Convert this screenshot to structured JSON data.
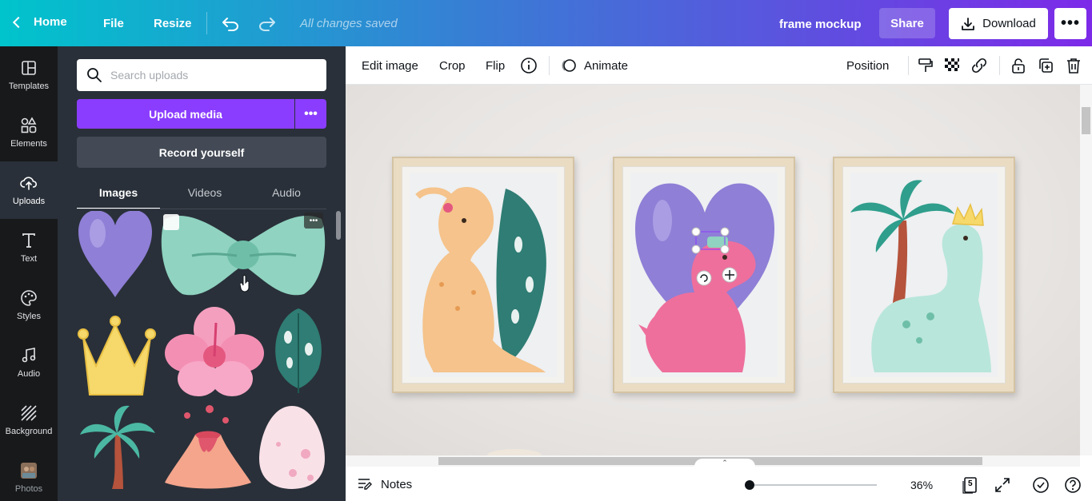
{
  "topbar": {
    "home_label": "Home",
    "file_label": "File",
    "resize_label": "Resize",
    "status": "All changes saved",
    "doc_title": "frame mockup",
    "share_label": "Share",
    "download_label": "Download",
    "gradient_colors": [
      "#00c4cc",
      "#3a7bd5",
      "#7d2ae8"
    ]
  },
  "rail": {
    "items": [
      {
        "label": "Templates",
        "icon": "templates-icon"
      },
      {
        "label": "Elements",
        "icon": "elements-icon"
      },
      {
        "label": "Uploads",
        "icon": "upload-cloud-icon",
        "active": true
      },
      {
        "label": "Text",
        "icon": "text-icon"
      },
      {
        "label": "Styles",
        "icon": "palette-icon"
      },
      {
        "label": "Audio",
        "icon": "music-note-icon"
      },
      {
        "label": "Background",
        "icon": "background-pattern-icon"
      },
      {
        "label": "Photos",
        "icon": "photos-icon"
      }
    ]
  },
  "panel": {
    "search_placeholder": "Search uploads",
    "upload_label": "Upload media",
    "record_label": "Record yourself",
    "tabs": [
      {
        "label": "Images",
        "active": true
      },
      {
        "label": "Videos"
      },
      {
        "label": "Audio"
      }
    ],
    "accent_color": "#8b3dff"
  },
  "context_toolbar": {
    "edit_image": "Edit image",
    "crop": "Crop",
    "flip": "Flip",
    "animate": "Animate",
    "position": "Position"
  },
  "bottombar": {
    "notes_label": "Notes",
    "zoom": "36%",
    "page_count": "5"
  }
}
